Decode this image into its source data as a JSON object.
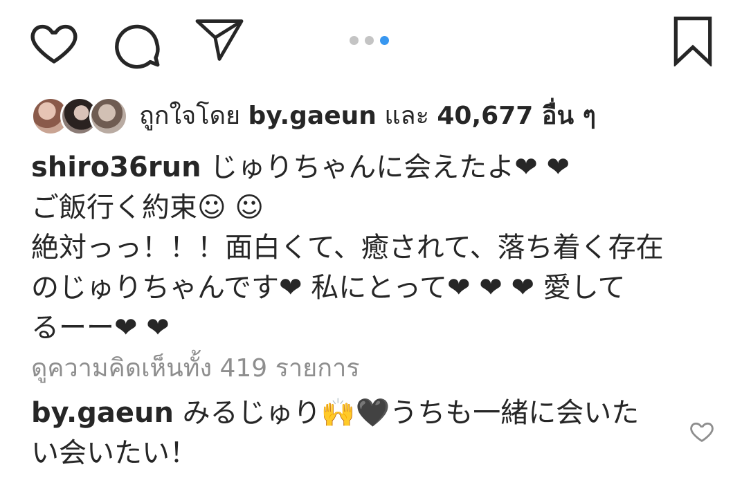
{
  "actions": {
    "like_icon": "heart-outline-icon",
    "comment_icon": "speech-bubble-icon",
    "share_icon": "paper-plane-icon",
    "save_icon": "bookmark-icon",
    "carousel_dots": 3,
    "carousel_active_index": 3,
    "accent_color": "#3897f0"
  },
  "likes": {
    "prefix": "ถูกใจโดย ",
    "user": "by.gaeun",
    "and": " และ ",
    "count": "40,677",
    "suffix": " อื่น ๆ"
  },
  "caption": {
    "user": "shiro36run",
    "lines": [
      " じゅりちゃんに会えたよ❤ ❤",
      "ご飯行く約束☺ ☺",
      "絶対っっ！！！面白くて、癒されて、落ち着く存在",
      "のじゅりちゃんです❤ 私にとって❤ ❤ ❤ 愛して",
      "るーー❤ ❤"
    ]
  },
  "view_all_comments": "ดูความคิดเห็นทั้ง 419 รายการ",
  "comment": {
    "user": "by.gaeun",
    "lines": [
      " みるじゅり🙌🖤うちも一緒に会いた",
      "い会いたい！"
    ]
  }
}
